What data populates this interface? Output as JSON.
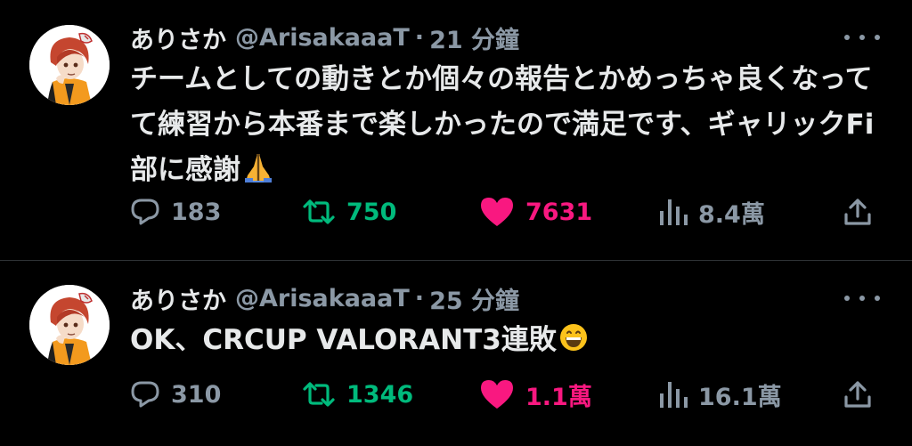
{
  "tweets": [
    {
      "display_name": "ありさか",
      "handle": "@ArisakaaaT",
      "separator": "·",
      "time": "21 分鐘",
      "text": "チームとしての動きとか個々の報告とかめっちゃ良くなってて練習から本番まで楽しかったので満足です、ギャリックFi部に感謝",
      "emoji": "folded-hands",
      "stats": {
        "replies": "183",
        "retweets": "750",
        "likes": "7631",
        "views": "8.4萬"
      }
    },
    {
      "display_name": "ありさか",
      "handle": "@ArisakaaaT",
      "separator": "·",
      "time": "25 分鐘",
      "text": "OK、CRCUP VALORANT3連敗",
      "emoji": "grinning-face",
      "stats": {
        "replies": "310",
        "retweets": "1346",
        "likes": "1.1萬",
        "views": "16.1萬"
      }
    }
  ],
  "colors": {
    "background": "#000000",
    "primary_text": "#e7e9ea",
    "secondary_text": "#8b98a5",
    "retweet_active": "#00ba7c",
    "like_active": "#f91880",
    "divider": "#2f3336"
  }
}
